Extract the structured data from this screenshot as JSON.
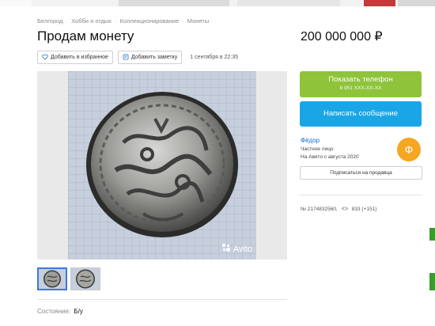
{
  "breadcrumb": [
    "Белгород",
    "Хобби и отдых",
    "Коллекционирование",
    "Монеты"
  ],
  "listing": {
    "title": "Продам монету",
    "price": "200 000 000 ₽",
    "date": "1 сентября в 22:35",
    "condition_label": "Состояние:",
    "condition_value": "Б/у"
  },
  "actions": {
    "favorite_label": "Добавить в избранное",
    "note_label": "Добавить заметку",
    "phone_label": "Показать телефон",
    "phone_masked": "8 951 XXX-XX-XX",
    "message_label": "Написать сообщение",
    "subscribe_label": "Подписаться на продавца"
  },
  "seller": {
    "name": "Фёдор",
    "type": "Частное лицо",
    "since": "На Авито с августа 2020",
    "avatar_letter": "Ф"
  },
  "meta": {
    "listing_id": "№ 2174832560,",
    "views": "833 (+151)"
  },
  "gallery": {
    "watermark": "Avito",
    "thumbnail_count": 2
  },
  "colors": {
    "phone_button": "#8ec33a",
    "message_button": "#1aa6e6",
    "link": "#1a6fd1",
    "avatar": "#f5a623"
  },
  "icons": [
    "heart-icon",
    "note-icon",
    "eye-icon",
    "avito-logo-icon"
  ]
}
